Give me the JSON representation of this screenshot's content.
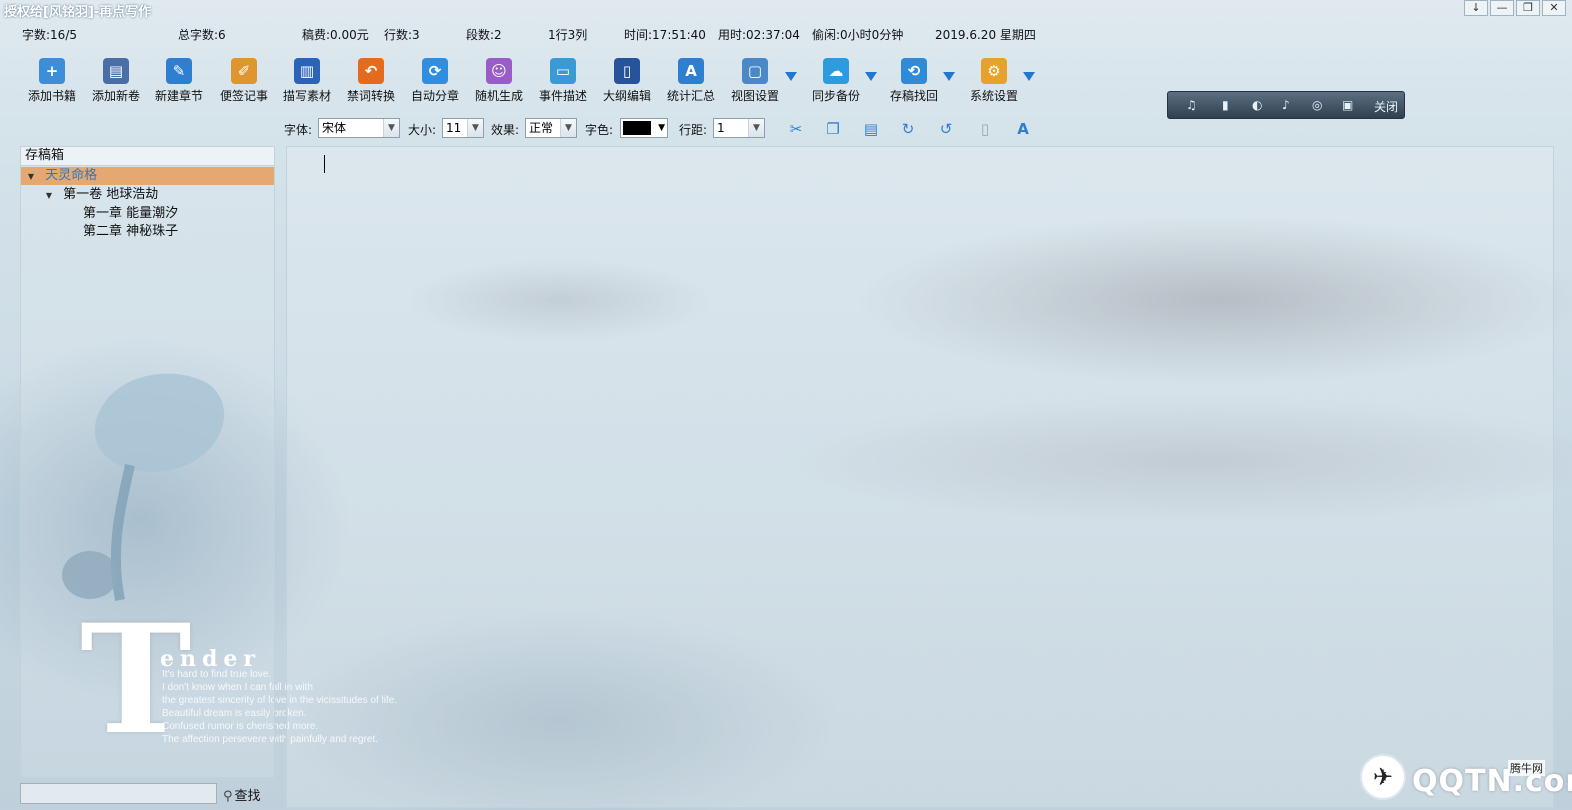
{
  "window": {
    "title": "授权给[风铭羽]-再点写作",
    "controls": [
      "↓",
      "—",
      "❐",
      "✕"
    ]
  },
  "status": {
    "word_count": "字数:16/5",
    "total_words": "总字数:6",
    "fee": "稿费:0.00元",
    "lines": "行数:3",
    "paragraphs": "段数:2",
    "cursor_pos": "1行3列",
    "time": "时间:17:51:40",
    "elapsed": "用时:02:37:04",
    "idle": "偷闲:0小时0分钟",
    "date": "2019.6.20  星期四"
  },
  "toolbar": {
    "items": [
      {
        "label": "添加书籍",
        "icon": "folder-add-icon",
        "color": "#3d8ed8"
      },
      {
        "label": "添加新卷",
        "icon": "books-icon",
        "color": "#4a6fa8"
      },
      {
        "label": "新建章节",
        "icon": "new-page-icon",
        "color": "#2f7fd0"
      },
      {
        "label": "便签记事",
        "icon": "note-icon",
        "color": "#e0962e"
      },
      {
        "label": "描写素材",
        "icon": "book-icon",
        "color": "#2a63b8"
      },
      {
        "label": "禁词转换",
        "icon": "undo-arrow-icon",
        "color": "#e46a1e"
      },
      {
        "label": "自动分章",
        "icon": "refresh-icon",
        "color": "#2f8ee0"
      },
      {
        "label": "随机生成",
        "icon": "people-icon",
        "color": "#9a5cc6"
      },
      {
        "label": "事件描述",
        "icon": "folder-icon",
        "color": "#3a9ad8"
      },
      {
        "label": "大纲编辑",
        "icon": "notebook-icon",
        "color": "#27539a"
      },
      {
        "label": "统计汇总",
        "icon": "font-plus-icon",
        "color": "#2f7fd0"
      },
      {
        "label": "视图设置",
        "icon": "window-icon",
        "color": "#4a88c8"
      },
      {
        "label": "同步备份",
        "icon": "cloud-icon",
        "color": "#2d9be0"
      },
      {
        "label": "存稿找回",
        "icon": "folder-restore-icon",
        "color": "#2f8ad8"
      },
      {
        "label": "系统设置",
        "icon": "gear-icon",
        "color": "#e8a12a"
      }
    ],
    "glyphs": [
      "+",
      "▤",
      "✎",
      "✐",
      "▥",
      "↶",
      "⟳",
      "☺",
      "▭",
      "▯",
      "A",
      "▢",
      "☁",
      "⟲",
      "⚙"
    ]
  },
  "minibar": {
    "items": [
      "♫",
      "▮",
      "◐",
      "♪",
      "◎",
      "▣"
    ],
    "close_label": "关闭"
  },
  "format": {
    "font_label": "字体:",
    "font_value": "宋体",
    "size_label": "大小:",
    "size_value": "11",
    "effect_label": "效果:",
    "effect_value": "正常",
    "color_label": "字色:",
    "spacing_label": "行距:",
    "spacing_value": "1",
    "tools": [
      {
        "name": "cut-icon",
        "glyph": "✂"
      },
      {
        "name": "copy-icon",
        "glyph": "❐"
      },
      {
        "name": "paste-icon",
        "glyph": "▤"
      },
      {
        "name": "redo-icon",
        "glyph": "↻"
      },
      {
        "name": "undo-icon",
        "glyph": "↺"
      },
      {
        "name": "clear-icon",
        "glyph": "▯"
      },
      {
        "name": "font-icon",
        "glyph": "A"
      }
    ]
  },
  "panel": {
    "header": "存稿箱",
    "book": "天灵命格",
    "volume": "第一卷  地球浩劫",
    "chapters": [
      "第一章  能量潮汐",
      "第二章  神秘珠子"
    ]
  },
  "search": {
    "value": "",
    "button_label": "查找"
  },
  "backdrop": {
    "letter": "T",
    "word": "ender",
    "lines": [
      "It's hard to find true love.",
      "I don't know when I can fall in with",
      "the greatest sincerity of love in the vicissitudes of life.",
      "Beautiful dream is easily broken.",
      "Confused rumor is cherished more.",
      "The affection persevere with painfully and regret."
    ]
  },
  "watermark": {
    "text": "QQTN.com",
    "sub": "腾牛网",
    "glyph": "✈"
  }
}
